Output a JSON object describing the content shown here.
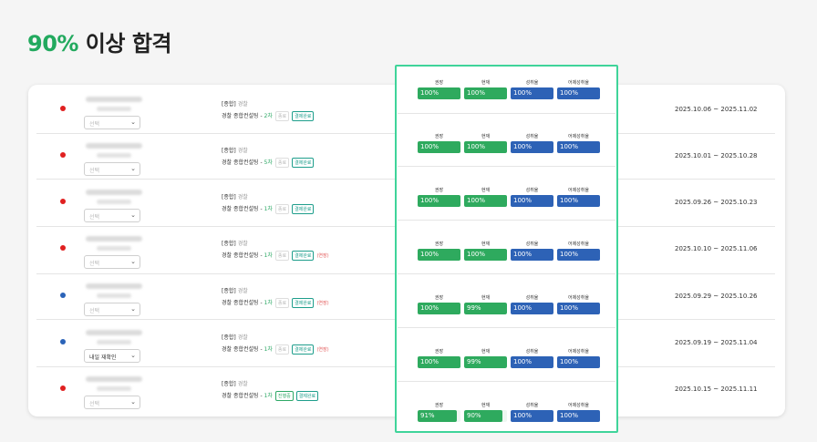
{
  "headline": {
    "accent": "90%",
    "rest": " 이상 합격"
  },
  "labels": {
    "m1": "권장",
    "m2": "현재",
    "m3": "성취율",
    "m4": "어제성취율"
  },
  "rows": [
    {
      "dot": "red",
      "select": "선택",
      "sel_filled": false,
      "info1": "[종합]",
      "info1_sub": "경찰",
      "course": "경찰 종합컨설팅 - ",
      "count": "2차",
      "tags": [
        {
          "t": "종료",
          "c": "muted"
        },
        {
          "t": "결제완료",
          "c": "paid"
        }
      ],
      "m": [
        {
          "v": "100%",
          "f": 1
        },
        {
          "v": "100%",
          "f": 1
        },
        {
          "v": "100%"
        },
        {
          "v": "100%"
        }
      ],
      "date": "2025.10.06 ~ 2025.11.02"
    },
    {
      "dot": "red",
      "select": "선택",
      "sel_filled": false,
      "info1": "[종합]",
      "info1_sub": "경찰",
      "course": "경찰 종합컨설팅 - ",
      "count": "5차",
      "tags": [
        {
          "t": "종료",
          "c": "muted"
        },
        {
          "t": "결제완료",
          "c": "paid"
        }
      ],
      "m": [
        {
          "v": "100%",
          "f": 1
        },
        {
          "v": "100%",
          "f": 1
        },
        {
          "v": "100%"
        },
        {
          "v": "100%"
        }
      ],
      "date": "2025.10.01 ~ 2025.10.28"
    },
    {
      "dot": "red",
      "select": "선택",
      "sel_filled": false,
      "info1": "[종합]",
      "info1_sub": "경찰",
      "course": "경찰 종합컨설팅 - ",
      "count": "1차",
      "tags": [
        {
          "t": "종료",
          "c": "muted"
        },
        {
          "t": "결제완료",
          "c": "paid"
        }
      ],
      "m": [
        {
          "v": "100%",
          "f": 1
        },
        {
          "v": "100%",
          "f": 1
        },
        {
          "v": "100%"
        },
        {
          "v": "100%"
        }
      ],
      "date": "2025.09.26 ~ 2025.10.23"
    },
    {
      "dot": "red",
      "select": "선택",
      "sel_filled": false,
      "info1": "[종합]",
      "info1_sub": "경찰",
      "course": "경찰 종합컨설팅 - ",
      "count": "1차",
      "tags": [
        {
          "t": "종료",
          "c": "muted"
        },
        {
          "t": "결제완료",
          "c": "paid"
        },
        {
          "t": "(연장)",
          "c": "ext"
        }
      ],
      "m": [
        {
          "v": "100%",
          "f": 1
        },
        {
          "v": "100%",
          "f": 1
        },
        {
          "v": "100%"
        },
        {
          "v": "100%"
        }
      ],
      "date": "2025.10.10 ~ 2025.11.06"
    },
    {
      "dot": "blue",
      "select": "선택",
      "sel_filled": false,
      "info1": "[종합]",
      "info1_sub": "경찰",
      "course": "경찰 종합컨설팅 - ",
      "count": "1차",
      "tags": [
        {
          "t": "종료",
          "c": "muted"
        },
        {
          "t": "결제완료",
          "c": "paid"
        },
        {
          "t": "(연장)",
          "c": "ext"
        }
      ],
      "m": [
        {
          "v": "100%",
          "f": 1
        },
        {
          "v": "99%",
          "f": 0.99
        },
        {
          "v": "100%"
        },
        {
          "v": "100%"
        }
      ],
      "date": "2025.09.29 ~ 2025.10.26"
    },
    {
      "dot": "blue",
      "select": "내일 재확인",
      "sel_filled": true,
      "info1": "[종합]",
      "info1_sub": "경찰",
      "course": "경찰 종합컨설팅 - ",
      "count": "1차",
      "tags": [
        {
          "t": "종료",
          "c": "muted"
        },
        {
          "t": "결제완료",
          "c": "paid"
        },
        {
          "t": "(연장)",
          "c": "ext"
        }
      ],
      "m": [
        {
          "v": "100%",
          "f": 1
        },
        {
          "v": "99%",
          "f": 0.99
        },
        {
          "v": "100%"
        },
        {
          "v": "100%"
        }
      ],
      "date": "2025.09.19 ~ 2025.11.04"
    },
    {
      "dot": "red",
      "select": "선택",
      "sel_filled": false,
      "info1": "[종합]",
      "info1_sub": "경찰",
      "course": "경찰 종합컨설팅 - ",
      "count": "1차",
      "tags": [
        {
          "t": "진행중",
          "c": "prog"
        },
        {
          "t": "결제완료",
          "c": "paid"
        }
      ],
      "m": [
        {
          "v": "91%",
          "f": 0.91
        },
        {
          "v": "90%",
          "f": 0.9
        },
        {
          "v": "100%"
        },
        {
          "v": "100%"
        }
      ],
      "date": "2025.10.15 ~ 2025.11.11"
    }
  ]
}
